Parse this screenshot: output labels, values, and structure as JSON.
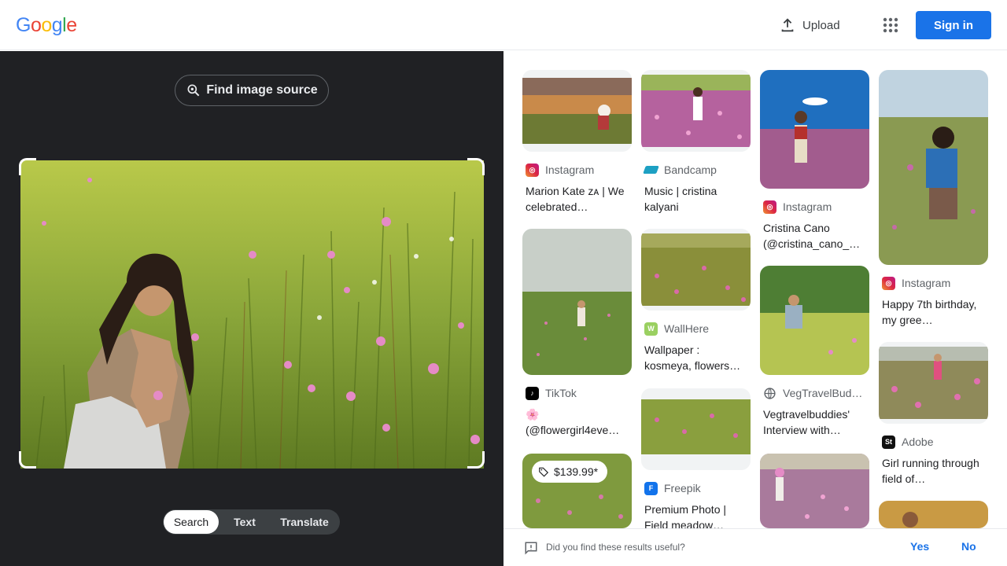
{
  "header": {
    "logo_letters": [
      {
        "char": "G",
        "color": "#4285F4"
      },
      {
        "char": "o",
        "color": "#EA4335"
      },
      {
        "char": "o",
        "color": "#FBBC05"
      },
      {
        "char": "g",
        "color": "#4285F4"
      },
      {
        "char": "l",
        "color": "#34A853"
      },
      {
        "char": "e",
        "color": "#EA4335"
      }
    ],
    "upload_label": "Upload",
    "apps_icon": "apps-grid-icon",
    "signin_label": "Sign in"
  },
  "lens": {
    "find_source_label": "Find image source",
    "tabs": [
      "Search",
      "Text",
      "Translate"
    ],
    "active_tab": "Search"
  },
  "results": [
    {
      "source": "Instagram",
      "title": "Marion Kate ᴢᴀ | We celebrated…",
      "favicon": "instagram-icon"
    },
    {
      "source": "Bandcamp",
      "title": "Music | cristina kalyani",
      "favicon": "bandcamp-icon"
    },
    {
      "source": "Instagram",
      "title": "Cristina Cano (@cristina_cano_…",
      "favicon": "instagram-icon"
    },
    {
      "source": "Instagram",
      "title": "Happy 7th birthday, my gree…",
      "favicon": "instagram-icon"
    },
    {
      "source": "WallHere",
      "title": "Wallpaper : kosmeya, flowers…",
      "favicon": "wallhere-icon"
    },
    {
      "source": "TikTok",
      "title": "🌸 (@flowergirl4eve…",
      "favicon": "tiktok-icon"
    },
    {
      "source": "VegTravelBud…",
      "title": "Vegtravelbuddies' Interview with…",
      "favicon": "globe-icon"
    },
    {
      "source": "Adobe",
      "title": "Girl running through field of…",
      "favicon": "adobe-stock-icon"
    },
    {
      "source": "Freepik",
      "title": "Premium Photo | Field meadow…",
      "favicon": "freepik-icon"
    }
  ],
  "price_badge": "$139.99*",
  "feedback": {
    "question": "Did you find these results useful?",
    "yes": "Yes",
    "no": "No"
  },
  "colors": {
    "accent": "#1a73e8",
    "dark_panel": "#202124"
  }
}
